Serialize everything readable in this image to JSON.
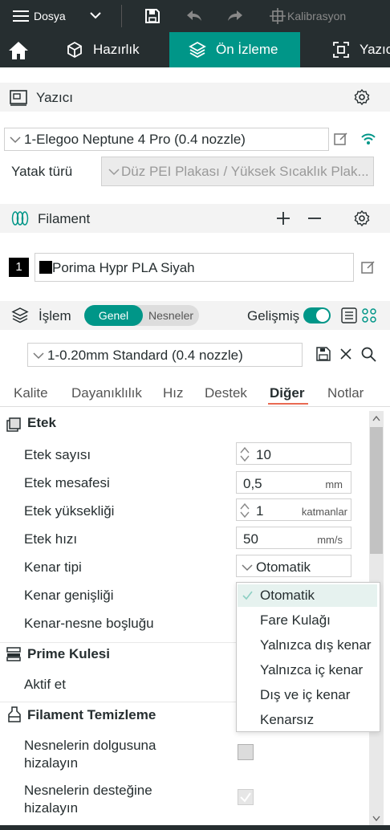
{
  "titlebar": {
    "file_label": "Dosya",
    "calibration_label": "Kalibrasyon"
  },
  "tabs": [
    {
      "label": "Hazırlık"
    },
    {
      "label": "Ön İzleme"
    },
    {
      "label": "Yazıcı"
    }
  ],
  "printer": {
    "section_title": "Yazıcı",
    "selected": "1-Elegoo Neptune 4 Pro (0.4 nozzle)",
    "bed_type_label": "Yatak türü",
    "bed_type_value": "Düz PEI Plakası / Yüksek Sıcaklık Plak..."
  },
  "filament": {
    "section_title": "Filament",
    "slot_number": "1",
    "name": "Porima Hypr PLA Siyah",
    "color": "#000000"
  },
  "process": {
    "section_title": "İşlem",
    "toggle_left": "Genel",
    "toggle_right": "Nesneler",
    "advanced_label": "Gelişmiş",
    "profile": "1-0.20mm Standard (0.4 nozzle)"
  },
  "subtabs": [
    {
      "label": "Kalite"
    },
    {
      "label": "Dayanıklılık"
    },
    {
      "label": "Hız"
    },
    {
      "label": "Destek"
    },
    {
      "label": "Diğer"
    },
    {
      "label": "Notlar"
    }
  ],
  "categories": {
    "skirt": "Etek",
    "prime_tower": "Prime Kulesi",
    "filament_purge": "Filament Temizleme"
  },
  "settings": {
    "skirt_loops": {
      "label": "Etek sayısı",
      "value": "10"
    },
    "skirt_distance": {
      "label": "Etek mesafesi",
      "value": "0,5",
      "unit": "mm"
    },
    "skirt_height": {
      "label": "Etek yüksekliği",
      "value": "1",
      "unit": "katmanlar"
    },
    "skirt_speed": {
      "label": "Etek hızı",
      "value": "50",
      "unit": "mm/s"
    },
    "brim_type": {
      "label": "Kenar tipi",
      "value": "Otomatik"
    },
    "brim_width": {
      "label": "Kenar genişliği"
    },
    "brim_gap": {
      "label": "Kenar-nesne boşluğu"
    },
    "prime_enable": {
      "label": "Aktif et"
    },
    "purge_infill": {
      "label_line1": "Nesnelerin dolgusuna",
      "label_line2": "hizalayın"
    },
    "purge_support": {
      "label_line1": "Nesnelerin desteğine",
      "label_line2": "hizalayın"
    }
  },
  "brim_dropdown": {
    "options": [
      "Otomatik",
      "Fare Kulağı",
      "Yalnızca dış kenar",
      "Yalnızca iç kenar",
      "Dış ve iç kenar",
      "Kenarsız"
    ]
  },
  "colors": {
    "accent": "#009688",
    "dark": "#262e30",
    "underline": "#e96a52"
  }
}
